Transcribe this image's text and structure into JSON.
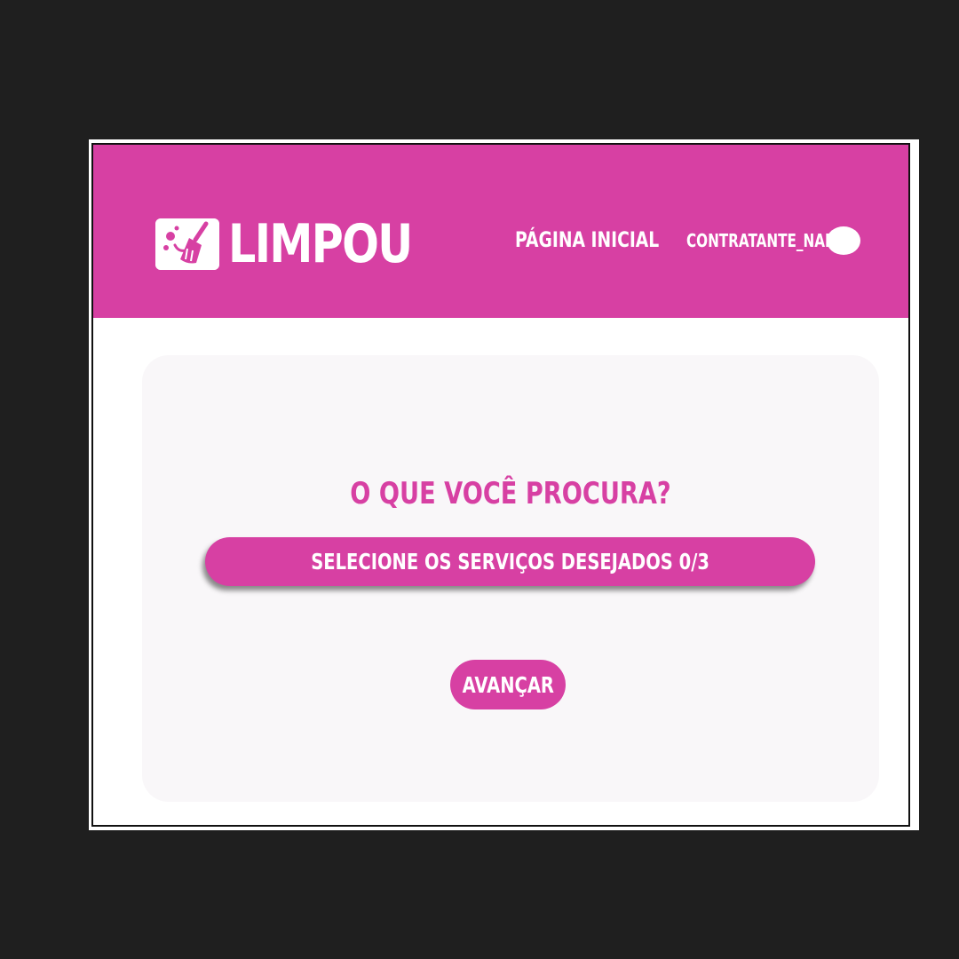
{
  "header": {
    "brand": "LIMPOU",
    "logo_icon": "broom-icon",
    "nav_home": "PÁGINA INICIAL",
    "user_name": "CONTRATANTE_NAME",
    "avatar_icon": "avatar-icon"
  },
  "main": {
    "question": "O QUE VOCÊ PROCURA?",
    "services_select": {
      "label": "SELECIONE OS SERVIÇOS DESEJADOS 0/3",
      "selected_count": 0,
      "max_count": 3
    },
    "next_button": "AVANÇAR"
  },
  "colors": {
    "brand_pink": "#d740a3",
    "page_background": "#1f1f1f",
    "card_background": "#f9f7f9",
    "text_on_brand": "#ffffff"
  }
}
